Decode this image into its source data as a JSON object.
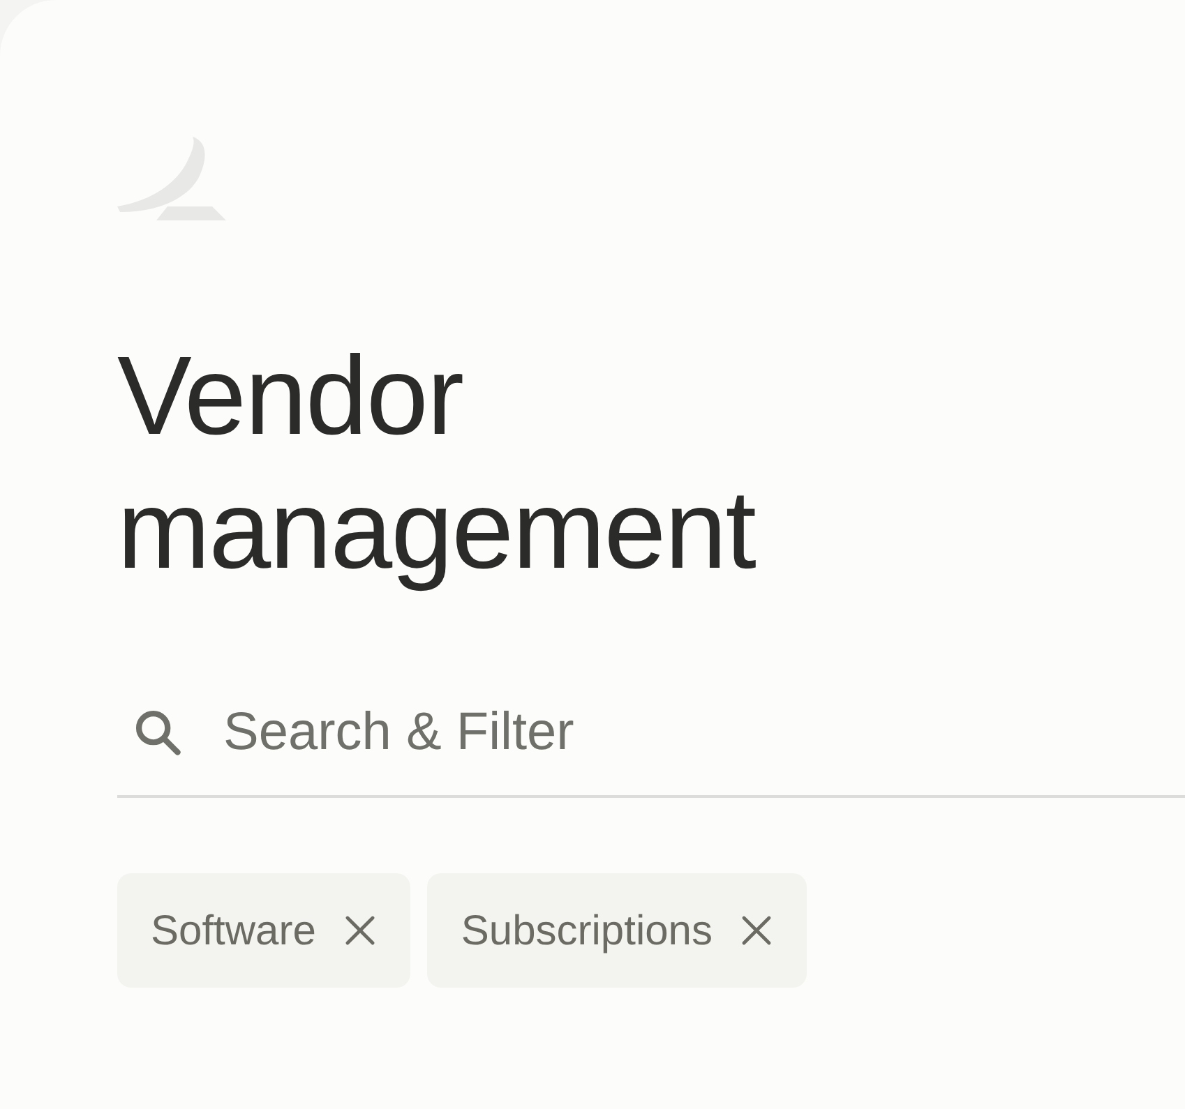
{
  "title": "Vendor management",
  "search": {
    "placeholder": "Search & Filter"
  },
  "filters": [
    {
      "label": "Software"
    },
    {
      "label": "Subscriptions"
    }
  ]
}
